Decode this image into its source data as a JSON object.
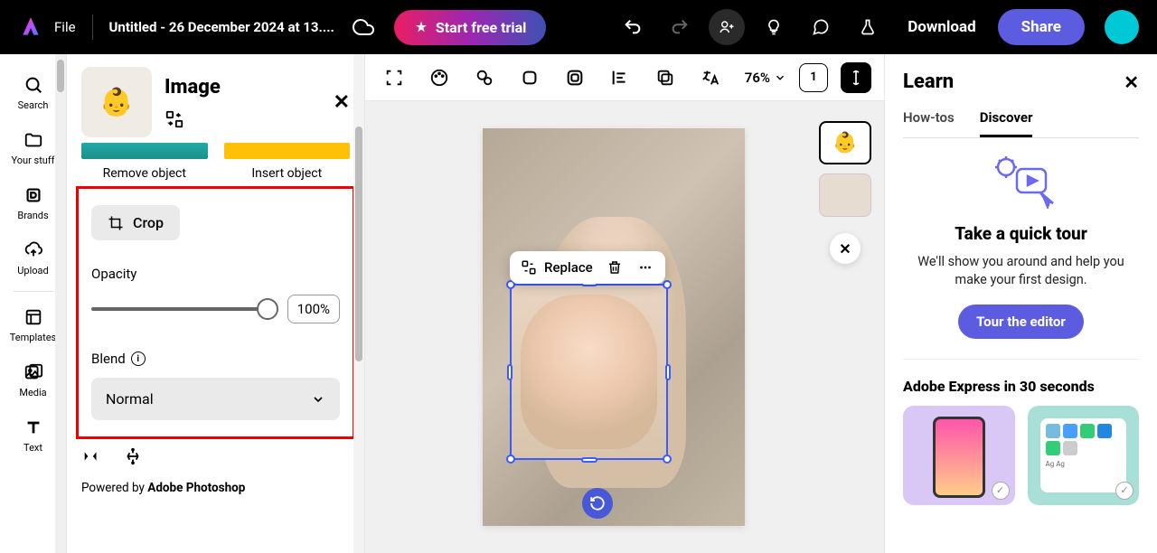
{
  "topbar": {
    "file_label": "File",
    "doc_title": "Untitled - 26 December 2024 at 13....",
    "trial_label": "Start free trial",
    "download_label": "Download",
    "share_label": "Share"
  },
  "left_rail": {
    "items": [
      {
        "label": "Search",
        "icon": "search-icon"
      },
      {
        "label": "Your stuff",
        "icon": "folder-icon"
      },
      {
        "label": "Brands",
        "icon": "brand-icon"
      },
      {
        "label": "Upload",
        "icon": "upload-icon"
      },
      {
        "label": "Templates",
        "icon": "templates-icon"
      },
      {
        "label": "Media",
        "icon": "media-icon"
      },
      {
        "label": "Text",
        "icon": "text-icon"
      }
    ]
  },
  "image_panel": {
    "title": "Image",
    "remove_object_label": "Remove object",
    "insert_object_label": "Insert object",
    "crop_label": "Crop",
    "opacity_label": "Opacity",
    "opacity_value": "100%",
    "blend_label": "Blend",
    "blend_mode": "Normal",
    "powered_prefix": "Powered by ",
    "powered_brand": "Adobe Photoshop"
  },
  "canvas_toolbar": {
    "zoom": "76%",
    "page_indicator": "1"
  },
  "floating_bar": {
    "replace_label": "Replace"
  },
  "learn_panel": {
    "title": "Learn",
    "tabs": {
      "howtos": "How-tos",
      "discover": "Discover"
    },
    "tour": {
      "title": "Take a quick tour",
      "desc": "We'll show you around and help you make your first design.",
      "button": "Tour the editor"
    },
    "section_title": "Adobe Express in 30 seconds"
  }
}
